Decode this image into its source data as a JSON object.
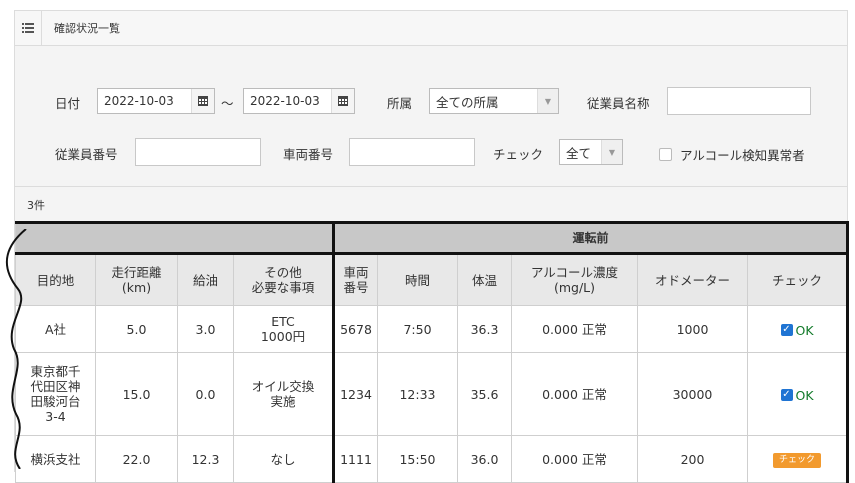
{
  "header": {
    "title": "確認状況一覧",
    "menu_icon": "list-icon"
  },
  "filters": {
    "date_label": "日付",
    "date_from": "2022-10-03",
    "tilde": "〜",
    "date_to": "2022-10-03",
    "affiliation_label": "所属",
    "affiliation_value": "全ての所属",
    "employee_name_label": "従業員名称",
    "employee_name_value": "",
    "employee_no_label": "従業員番号",
    "employee_no_value": "",
    "vehicle_no_label": "車両番号",
    "vehicle_no_value": "",
    "check_label": "チェック",
    "check_value": "全て",
    "alcohol_abnormal_label": "アルコール検知異常者"
  },
  "count_text": "3件",
  "table": {
    "group_header": "運転前",
    "columns": [
      "目的地",
      "走行距離\n(km)",
      "給油",
      "その他\n必要な事項",
      "車両\n番号",
      "時間",
      "体温",
      "アルコール濃度\n(mg/L)",
      "オドメーター",
      "チェック"
    ],
    "rows": [
      {
        "dest": "A社",
        "distance": "5.0",
        "fuel": "3.0",
        "other": "ETC\n1000円",
        "vehicle": "5678",
        "time": "7:50",
        "temp": "36.3",
        "alcohol": "0.000 正常",
        "odometer": "1000",
        "check": "OK",
        "check_type": "ok"
      },
      {
        "dest": "東京都千\n代田区神\n田駿河台\n3-4",
        "distance": "15.0",
        "fuel": "0.0",
        "other": "オイル交換\n実施",
        "vehicle": "1234",
        "time": "12:33",
        "temp": "35.6",
        "alcohol": "0.000 正常",
        "odometer": "30000",
        "check": "OK",
        "check_type": "ok"
      },
      {
        "dest": "横浜支社",
        "distance": "22.0",
        "fuel": "12.3",
        "other": "なし",
        "vehicle": "1111",
        "time": "15:50",
        "temp": "36.0",
        "alcohol": "0.000 正常",
        "odometer": "200",
        "check": "チェック",
        "check_type": "button"
      }
    ]
  },
  "colors": {
    "ok_green": "#127a2a",
    "check_orange": "#f29a2e",
    "checkbox_blue": "#1f74d3",
    "group_header_bg": "#c8c8c8"
  }
}
